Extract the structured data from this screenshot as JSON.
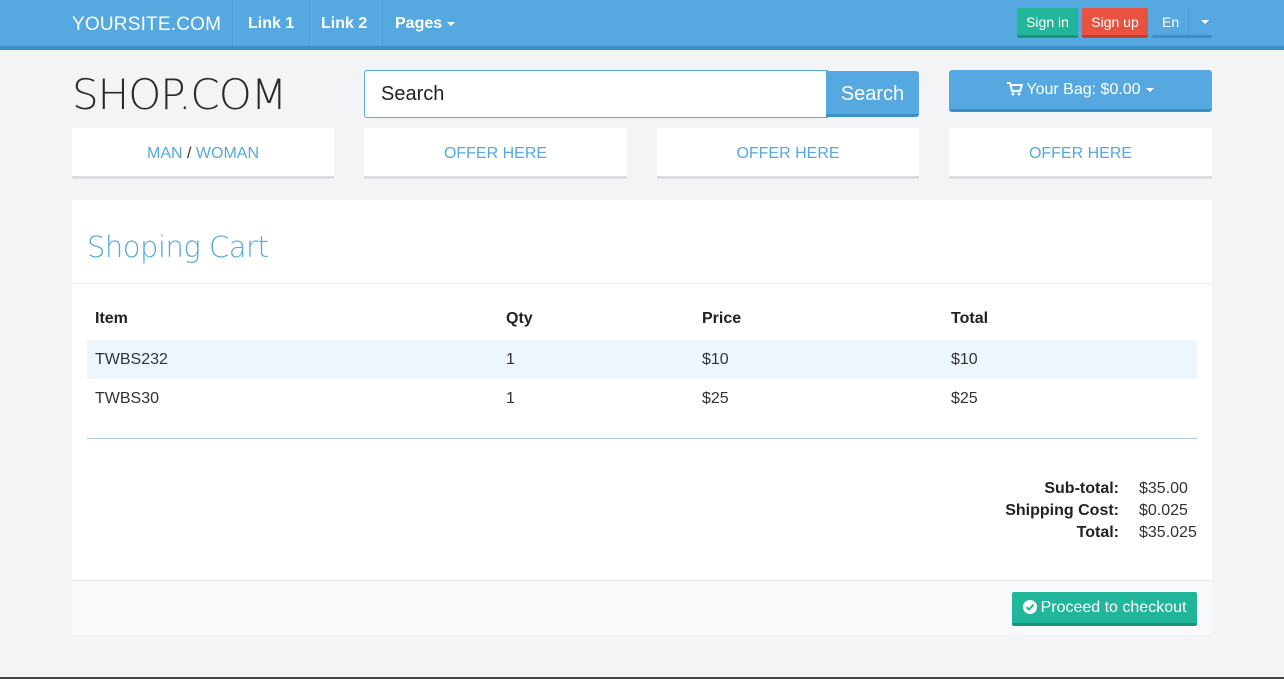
{
  "navbar": {
    "brand": "YOURSITE.COM",
    "links": [
      "Link 1",
      "Link 2",
      "Pages"
    ],
    "signin": "Sign in",
    "signup": "Sign up",
    "language": "En"
  },
  "header": {
    "logo": "SHOP.COM",
    "search_value": "Search",
    "search_button": "Search",
    "bag_label": "Your Bag: $0.00"
  },
  "offers": {
    "first": {
      "man": "MAN",
      "separator": "/",
      "woman": "WOMAN"
    },
    "items": [
      "OFFER HERE",
      "OFFER HERE",
      "OFFER HERE"
    ]
  },
  "cart": {
    "title": "Shoping Cart",
    "columns": [
      "Item",
      "Qty",
      "Price",
      "Total"
    ],
    "rows": [
      [
        "TWBS232",
        "1",
        "$10",
        "$10"
      ],
      [
        "TWBS30",
        "1",
        "$25",
        "$25"
      ]
    ],
    "summary": {
      "subtotal_label": "Sub-total:",
      "subtotal_value": "$35.00",
      "shipping_label": "Shipping Cost:",
      "shipping_value": "$0.025",
      "total_label": "Total:",
      "total_value": "$35.025"
    },
    "checkout_button": "Proceed to checkout"
  },
  "colors": {
    "primary": "#55a8e0",
    "success": "#21b59a",
    "danger": "#e8523f"
  }
}
